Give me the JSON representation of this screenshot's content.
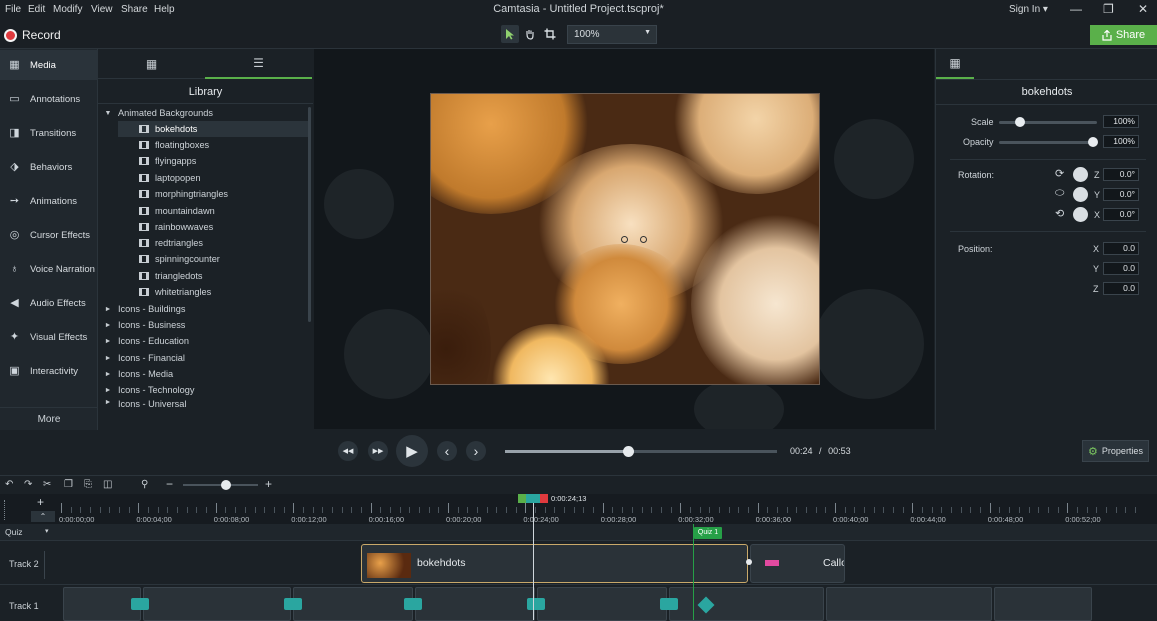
{
  "menubar": {
    "items": [
      "File",
      "Edit",
      "Modify",
      "View",
      "Share",
      "Help"
    ],
    "window_title": "Camtasia - Untitled Project.tscproj*",
    "sign_in": "Sign In",
    "sign_in_caret": "▾",
    "minimize": "—",
    "maximize": "❐",
    "close": "✕"
  },
  "toolbar": {
    "record_label": "Record",
    "zoom_value": "100%",
    "share_label": "Share",
    "colors": {
      "record": "#e03a3e",
      "share": "#5ab04a"
    }
  },
  "sidebar": {
    "items": [
      {
        "label": "Media",
        "icon": "film-strip-icon",
        "glyph": "▦"
      },
      {
        "label": "Annotations",
        "icon": "annotation-icon",
        "glyph": "▭"
      },
      {
        "label": "Transitions",
        "icon": "transition-icon",
        "glyph": "◨"
      },
      {
        "label": "Behaviors",
        "icon": "behaviors-icon",
        "glyph": "⬗"
      },
      {
        "label": "Animations",
        "icon": "animation-arrow-icon",
        "glyph": "➙"
      },
      {
        "label": "Cursor Effects",
        "icon": "cursor-effects-icon",
        "glyph": "◎"
      },
      {
        "label": "Voice Narration",
        "icon": "microphone-icon",
        "glyph": "♁"
      },
      {
        "label": "Audio Effects",
        "icon": "speaker-icon",
        "glyph": "◀"
      },
      {
        "label": "Visual Effects",
        "icon": "magic-wand-icon",
        "glyph": "✦"
      },
      {
        "label": "Interactivity",
        "icon": "interactivity-icon",
        "glyph": "▣"
      }
    ],
    "more_label": "More",
    "add_glyph": "+"
  },
  "library": {
    "tab_media_glyph": "▦",
    "tab_library_glyph": "☰",
    "title": "Library",
    "open_folder": "Animated Backgrounds",
    "open_caret": "▼",
    "closed_caret": "►",
    "items": [
      "bokehdots",
      "floatingboxes",
      "flyingapps",
      "laptopopen",
      "morphingtriangles",
      "mountaindawn",
      "rainbowwaves",
      "redtriangles",
      "spinningcounter",
      "triangledots",
      "whitetriangles"
    ],
    "selected": "bokehdots",
    "folders": [
      "Icons - Buildings",
      "Icons - Business",
      "Icons - Education",
      "Icons - Financial",
      "Icons - Media",
      "Icons - Technology",
      "Icons - Universal"
    ]
  },
  "properties": {
    "tab_glyph": "▦",
    "title": "bokehdots",
    "scale_label": "Scale",
    "scale_value": "100%",
    "scale_level": 0.2,
    "opacity_label": "Opacity",
    "opacity_value": "100%",
    "opacity_level": 1.0,
    "rotation_label": "Rotation:",
    "rotation": [
      {
        "axis": "Z",
        "value": "0.0°",
        "icon": "rotate-z-icon",
        "glyph": "⟳"
      },
      {
        "axis": "Y",
        "value": "0.0°",
        "icon": "rotate-y-icon",
        "glyph": "⬭"
      },
      {
        "axis": "X",
        "value": "0.0°",
        "icon": "rotate-x-icon",
        "glyph": "⟲"
      }
    ],
    "position_label": "Position:",
    "position": [
      {
        "axis": "X",
        "value": "0.0"
      },
      {
        "axis": "Y",
        "value": "0.0"
      },
      {
        "axis": "Z",
        "value": "0.0"
      }
    ]
  },
  "playback": {
    "prev_frame_glyph": "◀◀",
    "next_frame_glyph": "▶▶",
    "play_glyph": "▶",
    "prev_glyph": "‹",
    "next_glyph": "›",
    "current_time": "00:24",
    "separator": "/",
    "total_time": "00:53",
    "progress": 0.45,
    "properties_label": "Properties",
    "gear_glyph": "⚙"
  },
  "timeline": {
    "tools": {
      "undo": "↶",
      "redo": "↷",
      "cut": "✂",
      "copy": "❐",
      "paste": "⎘",
      "split": "◫",
      "zoom": "⚲",
      "zoom_out": "−",
      "zoom_in": "+"
    },
    "zoom_level": 0.6,
    "playhead_time": "0:00:24;13",
    "ruler_labels": [
      "0:00:00;00",
      "0:00:04;00",
      "0:00:08;00",
      "0:00:12;00",
      "0:00:16;00",
      "0:00:20;00",
      "0:00:24;00",
      "0:00:28;00",
      "0:00:32;00",
      "0:00:36;00",
      "0:00:40;00",
      "0:00:44;00",
      "0:00:48;00",
      "0:00:52;00"
    ],
    "add_track_glyph": "+",
    "collapse_glyph": "⌃",
    "quiz_label": "Quiz",
    "quiz_caret": "▾",
    "quiz_marker": "Quiz 1",
    "tracks": [
      {
        "label": "Track 2",
        "clips": [
          {
            "label": "bokehdots"
          },
          {
            "label": "Callo"
          }
        ]
      },
      {
        "label": "Track 1"
      }
    ]
  }
}
